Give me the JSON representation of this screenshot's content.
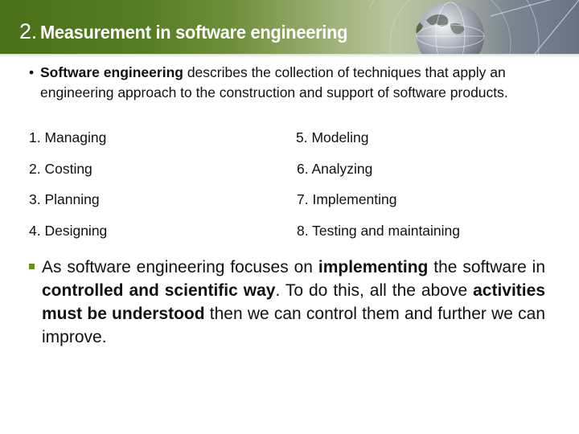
{
  "header": {
    "title_number": "2.",
    "title_text": "Measurement in software engineering",
    "colors": {
      "band_start": "#4b7118",
      "band_mid": "#b8c69e",
      "band_end": "#6a7480"
    }
  },
  "intro": {
    "bullet": "•",
    "bold_lead": "Software engineering",
    "rest": " describes the collection of techniques that apply an engineering approach to the construction and support of software products."
  },
  "activities": [
    "1. Managing",
    "2. Costing",
    "3. Planning",
    "4. Designing",
    "5. Modeling",
    "6. Analyzing",
    "7. Implementing",
    "8. Testing and maintaining"
  ],
  "paragraph": {
    "bullet_color": "#6b8e23",
    "segments": [
      {
        "text": "As software engineering focuses on ",
        "bold": false
      },
      {
        "text": "implementing",
        "bold": true
      },
      {
        "text": " the software in ",
        "bold": false
      },
      {
        "text": "controlled and scientific way",
        "bold": true
      },
      {
        "text": ". To do this, all the above ",
        "bold": false
      },
      {
        "text": "activities must be understood",
        "bold": true
      },
      {
        "text": " then we can control them and further we can improve.",
        "bold": false
      }
    ]
  }
}
